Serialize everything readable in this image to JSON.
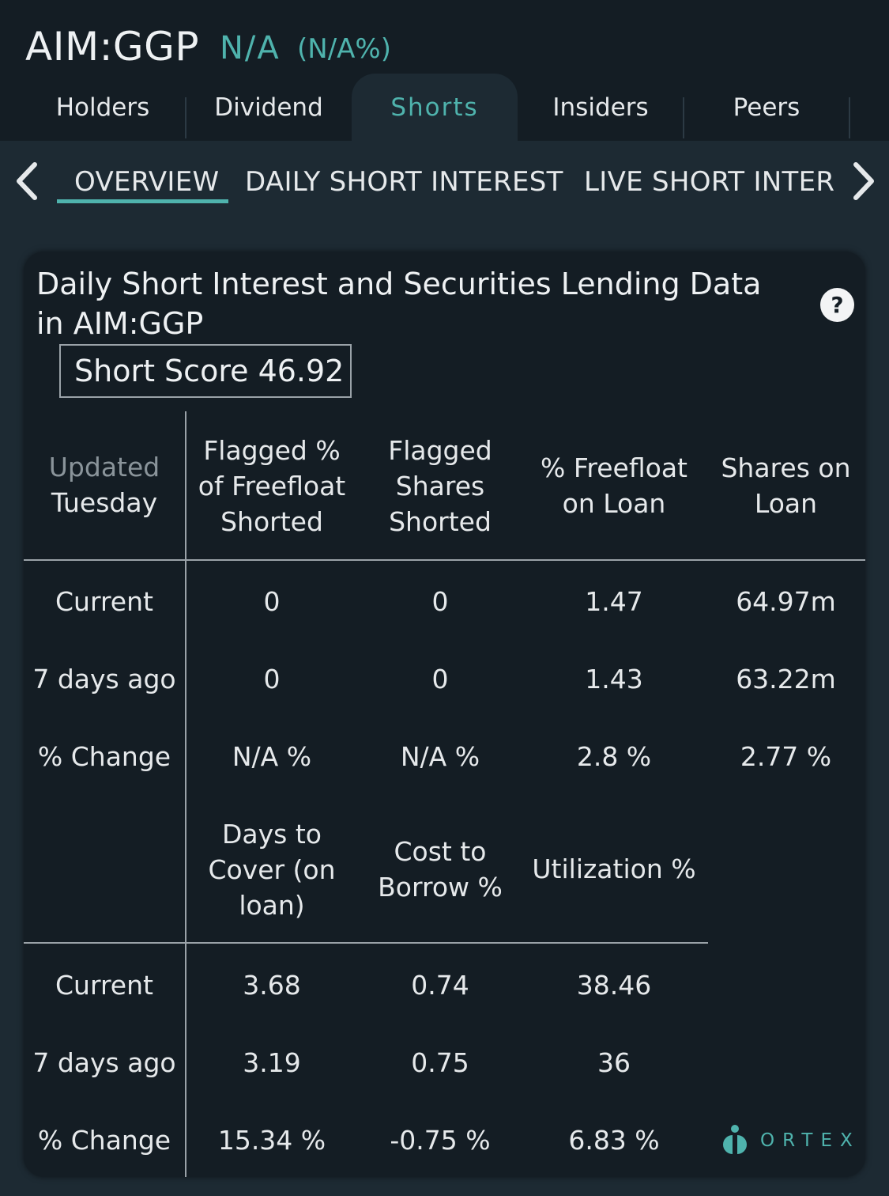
{
  "header": {
    "ticker": "AIM:GGP",
    "price": "N/A",
    "change_pct": "(N/A%)"
  },
  "tabs": [
    {
      "label": "Holders",
      "active": false
    },
    {
      "label": "Dividend",
      "active": false
    },
    {
      "label": "Shorts",
      "active": true
    },
    {
      "label": "Insiders",
      "active": false
    },
    {
      "label": "Peers",
      "active": false
    }
  ],
  "subnav": {
    "items": [
      {
        "label": "OVERVIEW",
        "active": true
      },
      {
        "label": "DAILY SHORT INTEREST",
        "active": false
      },
      {
        "label": "LIVE SHORT INTEREST",
        "active": false
      }
    ],
    "prev_icon": "chevron-left-icon",
    "next_icon": "chevron-right-icon"
  },
  "card": {
    "title": "Daily Short Interest and Securities Lending Data in AIM:GGP",
    "short_score_label": "Short Score 46.92",
    "help_icon": "?",
    "updated_label": "Updated",
    "updated_day": "Tuesday",
    "table1": {
      "headers": [
        "Flagged % of Freefloat Shorted",
        "Flagged Shares Shorted",
        "% Freefloat on Loan",
        "Shares on Loan"
      ],
      "rows": [
        {
          "label": "Current",
          "values": [
            "0",
            "0",
            "1.47",
            "64.97m"
          ]
        },
        {
          "label": "7 days ago",
          "values": [
            "0",
            "0",
            "1.43",
            "63.22m"
          ]
        },
        {
          "label": "% Change",
          "values": [
            "N/A %",
            "N/A %",
            "2.8 %",
            "2.77 %"
          ]
        }
      ]
    },
    "table2": {
      "headers": [
        "Days to Cover (on loan)",
        "Cost to Borrow %",
        "Utilization %"
      ],
      "rows": [
        {
          "label": "Current",
          "values": [
            "3.68",
            "0.74",
            "38.46"
          ]
        },
        {
          "label": "7 days ago",
          "values": [
            "3.19",
            "0.75",
            "36"
          ]
        },
        {
          "label": "% Change",
          "values": [
            "15.34 %",
            "-0.75 %",
            "6.83 %"
          ]
        }
      ]
    },
    "brand": "ORTEX"
  },
  "colors": {
    "accent": "#4fb3ad",
    "background": "#1d2a33",
    "panel": "#141d24"
  }
}
